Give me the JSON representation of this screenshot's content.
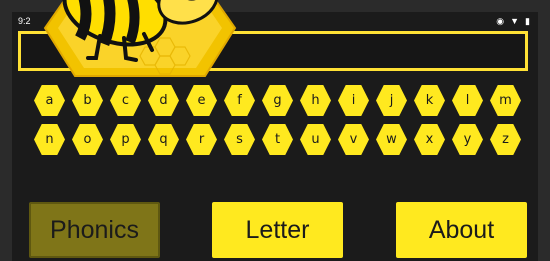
{
  "status": {
    "time": "9:2",
    "icons": [
      "eye-icon",
      "wifi-icon",
      "battery-icon"
    ]
  },
  "keyboard": {
    "row1": [
      "a",
      "b",
      "c",
      "d",
      "e",
      "f",
      "g",
      "h",
      "i",
      "j",
      "k",
      "l",
      "m"
    ],
    "row2": [
      "n",
      "o",
      "p",
      "q",
      "r",
      "s",
      "t",
      "u",
      "v",
      "w",
      "x",
      "y",
      "z"
    ]
  },
  "buttons": {
    "phonics": "Phonics",
    "letter": "Letter",
    "about": "About"
  },
  "colors": {
    "accent": "#ffe91f",
    "selected": "#7f7518",
    "background": "#1b1b1b"
  }
}
